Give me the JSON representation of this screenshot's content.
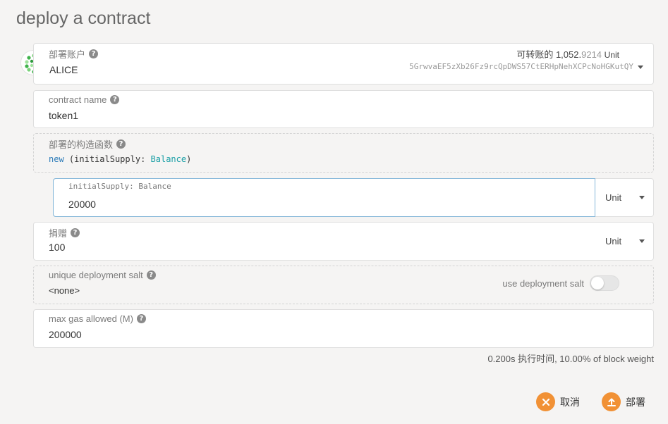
{
  "page": {
    "title": "deploy a contract"
  },
  "account": {
    "label": "部署账户",
    "name": "ALICE",
    "transferable_label": "可转账的",
    "balance_main": "1,052.",
    "balance_decimals": "9214",
    "balance_unit": "Unit",
    "address": "5GrwvaEF5zXb26Fz9rcQpDWS57CtERHpNehXCPcNoHGKutQY"
  },
  "contract_name": {
    "label": "contract name",
    "value": "token1"
  },
  "constructor": {
    "label": "部署的构造函数",
    "keyword": "new",
    "param_name": "initialSupply",
    "param_type": "Balance"
  },
  "initial_supply": {
    "label": "initialSupply: Balance",
    "value": "20000",
    "unit": "Unit"
  },
  "endowment": {
    "label": "捐赠",
    "value": "100",
    "unit": "Unit"
  },
  "salt": {
    "label": "unique deployment salt",
    "value": "<none>",
    "toggle_label": "use deployment salt",
    "toggle_on": false
  },
  "gas": {
    "label": "max gas allowed (M)",
    "value": "200000"
  },
  "weight_info": "0.200s 执行时间, 10.00% of block weight",
  "actions": {
    "cancel": "取消",
    "deploy": "部署"
  },
  "colors": {
    "accent": "#f19135",
    "input_focus": "#85b7d9",
    "type_color": "#1a9fa6",
    "keyword_color": "#2a7ab8"
  }
}
